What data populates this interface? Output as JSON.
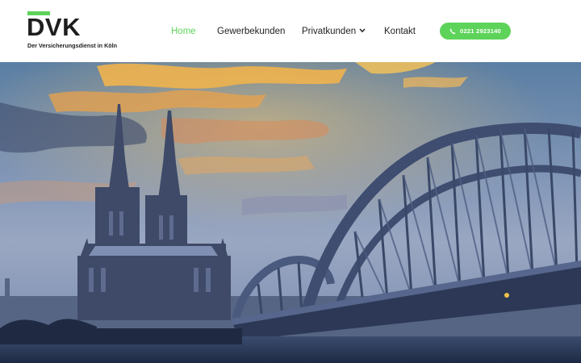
{
  "brand": {
    "name": "DVK",
    "tagline": "Der Versicherungsdienst in Köln",
    "accent_color": "#5ed35a"
  },
  "nav": {
    "items": [
      {
        "label": "Home",
        "active": true
      },
      {
        "label": "Gewerbekunden",
        "active": false
      },
      {
        "label": "Privatkunden",
        "active": false,
        "has_dropdown": true
      },
      {
        "label": "Kontakt",
        "active": false
      }
    ]
  },
  "cta": {
    "label": "0221 2923140",
    "icon": "phone-icon"
  },
  "hero": {
    "image": "cologne-cathedral-and-hohenzollern-bridge-at-sunset"
  }
}
